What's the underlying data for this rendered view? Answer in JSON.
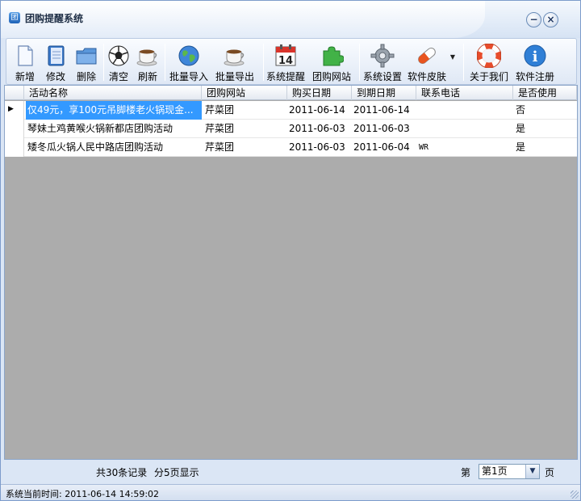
{
  "window": {
    "title": "团购提醒系统",
    "minimize_glyph": "−",
    "close_glyph": "×"
  },
  "toolbar": {
    "buttons": [
      {
        "label": "新增",
        "icon": "new-document-icon"
      },
      {
        "label": "修改",
        "icon": "notebook-edit-icon"
      },
      {
        "label": "删除",
        "icon": "folder-delete-icon"
      },
      {
        "label": "清空",
        "icon": "soccer-ball-icon"
      },
      {
        "label": "刷新",
        "icon": "coffee-cup-icon"
      },
      {
        "label": "批量导入",
        "icon": "globe-icon"
      },
      {
        "label": "批量导出",
        "icon": "coffee-cup-icon"
      },
      {
        "label": "系统提醒",
        "icon": "calendar-icon"
      },
      {
        "label": "团购网站",
        "icon": "puzzle-icon"
      },
      {
        "label": "系统设置",
        "icon": "gear-icon"
      },
      {
        "label": "软件皮肤",
        "icon": "pill-icon"
      },
      {
        "label": "关于我们",
        "icon": "lifebuoy-icon"
      },
      {
        "label": "软件注册",
        "icon": "info-icon"
      }
    ],
    "calendar_day": "14",
    "info_glyph": "i"
  },
  "grid": {
    "columns": [
      "活动名称",
      "团购网站",
      "购买日期",
      "到期日期",
      "联系电话",
      "是否使用"
    ],
    "current_row_marker": "▶",
    "rows": [
      [
        "仅49元，享100元吊脚楼老火锅现金...",
        "芹菜团",
        "2011-06-14",
        "2011-06-14",
        "",
        "否"
      ],
      [
        "琴妹土鸡黄喉火锅新都店团购活动",
        "芹菜团",
        "2011-06-03",
        "2011-06-03",
        "",
        "是"
      ],
      [
        "矮冬瓜火锅人民中路店团购活动",
        "芹菜团",
        "2011-06-03",
        "2011-06-04",
        "WR",
        "是"
      ]
    ]
  },
  "pager": {
    "total_records": "共30条记录",
    "total_pages": "分5页显示",
    "prefix": "第",
    "current_page": "第1页",
    "suffix": "页"
  },
  "status": {
    "text": "系统当前时间: 2011-06-14 14:59:02"
  },
  "colors": {
    "selection": "#3399ff",
    "grid_background": "#acacac",
    "frame": "#dbe6f5"
  }
}
